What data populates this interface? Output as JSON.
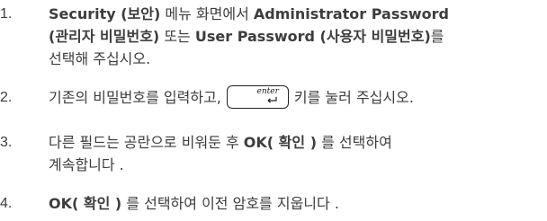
{
  "steps": [
    {
      "number": "1.",
      "line1": [
        {
          "text": "Security (보안)",
          "bold": true
        },
        {
          "text": " 메뉴 화면에서 ",
          "bold": false
        },
        {
          "text": "Administrator Password",
          "bold": true
        }
      ],
      "line2": [
        {
          "text": "(관리자 비밀번호)",
          "bold": true
        },
        {
          "text": " 또는 ",
          "bold": false
        },
        {
          "text": "User Password (사용자 비밀번호)",
          "bold": true
        },
        {
          "text": "를",
          "bold": false
        }
      ],
      "line3": "선택해 주십시오."
    },
    {
      "number": "2.",
      "before_key": "기존의 비밀번호를 입력하고,",
      "key_label": "enter",
      "after_key": "키를 눌러 주십시오."
    },
    {
      "number": "3.",
      "line1_pre": "다른 필드는 공란으로 비워둔 후 ",
      "line1_bold": "OK( 확인 )",
      "line1_post": " 를 선택하여",
      "line2": "계속합니다 ."
    },
    {
      "number": "4.",
      "bold": "OK( 확인 )",
      "post": " 를 선택하여 이전 암호를 지웁니다 ."
    }
  ]
}
